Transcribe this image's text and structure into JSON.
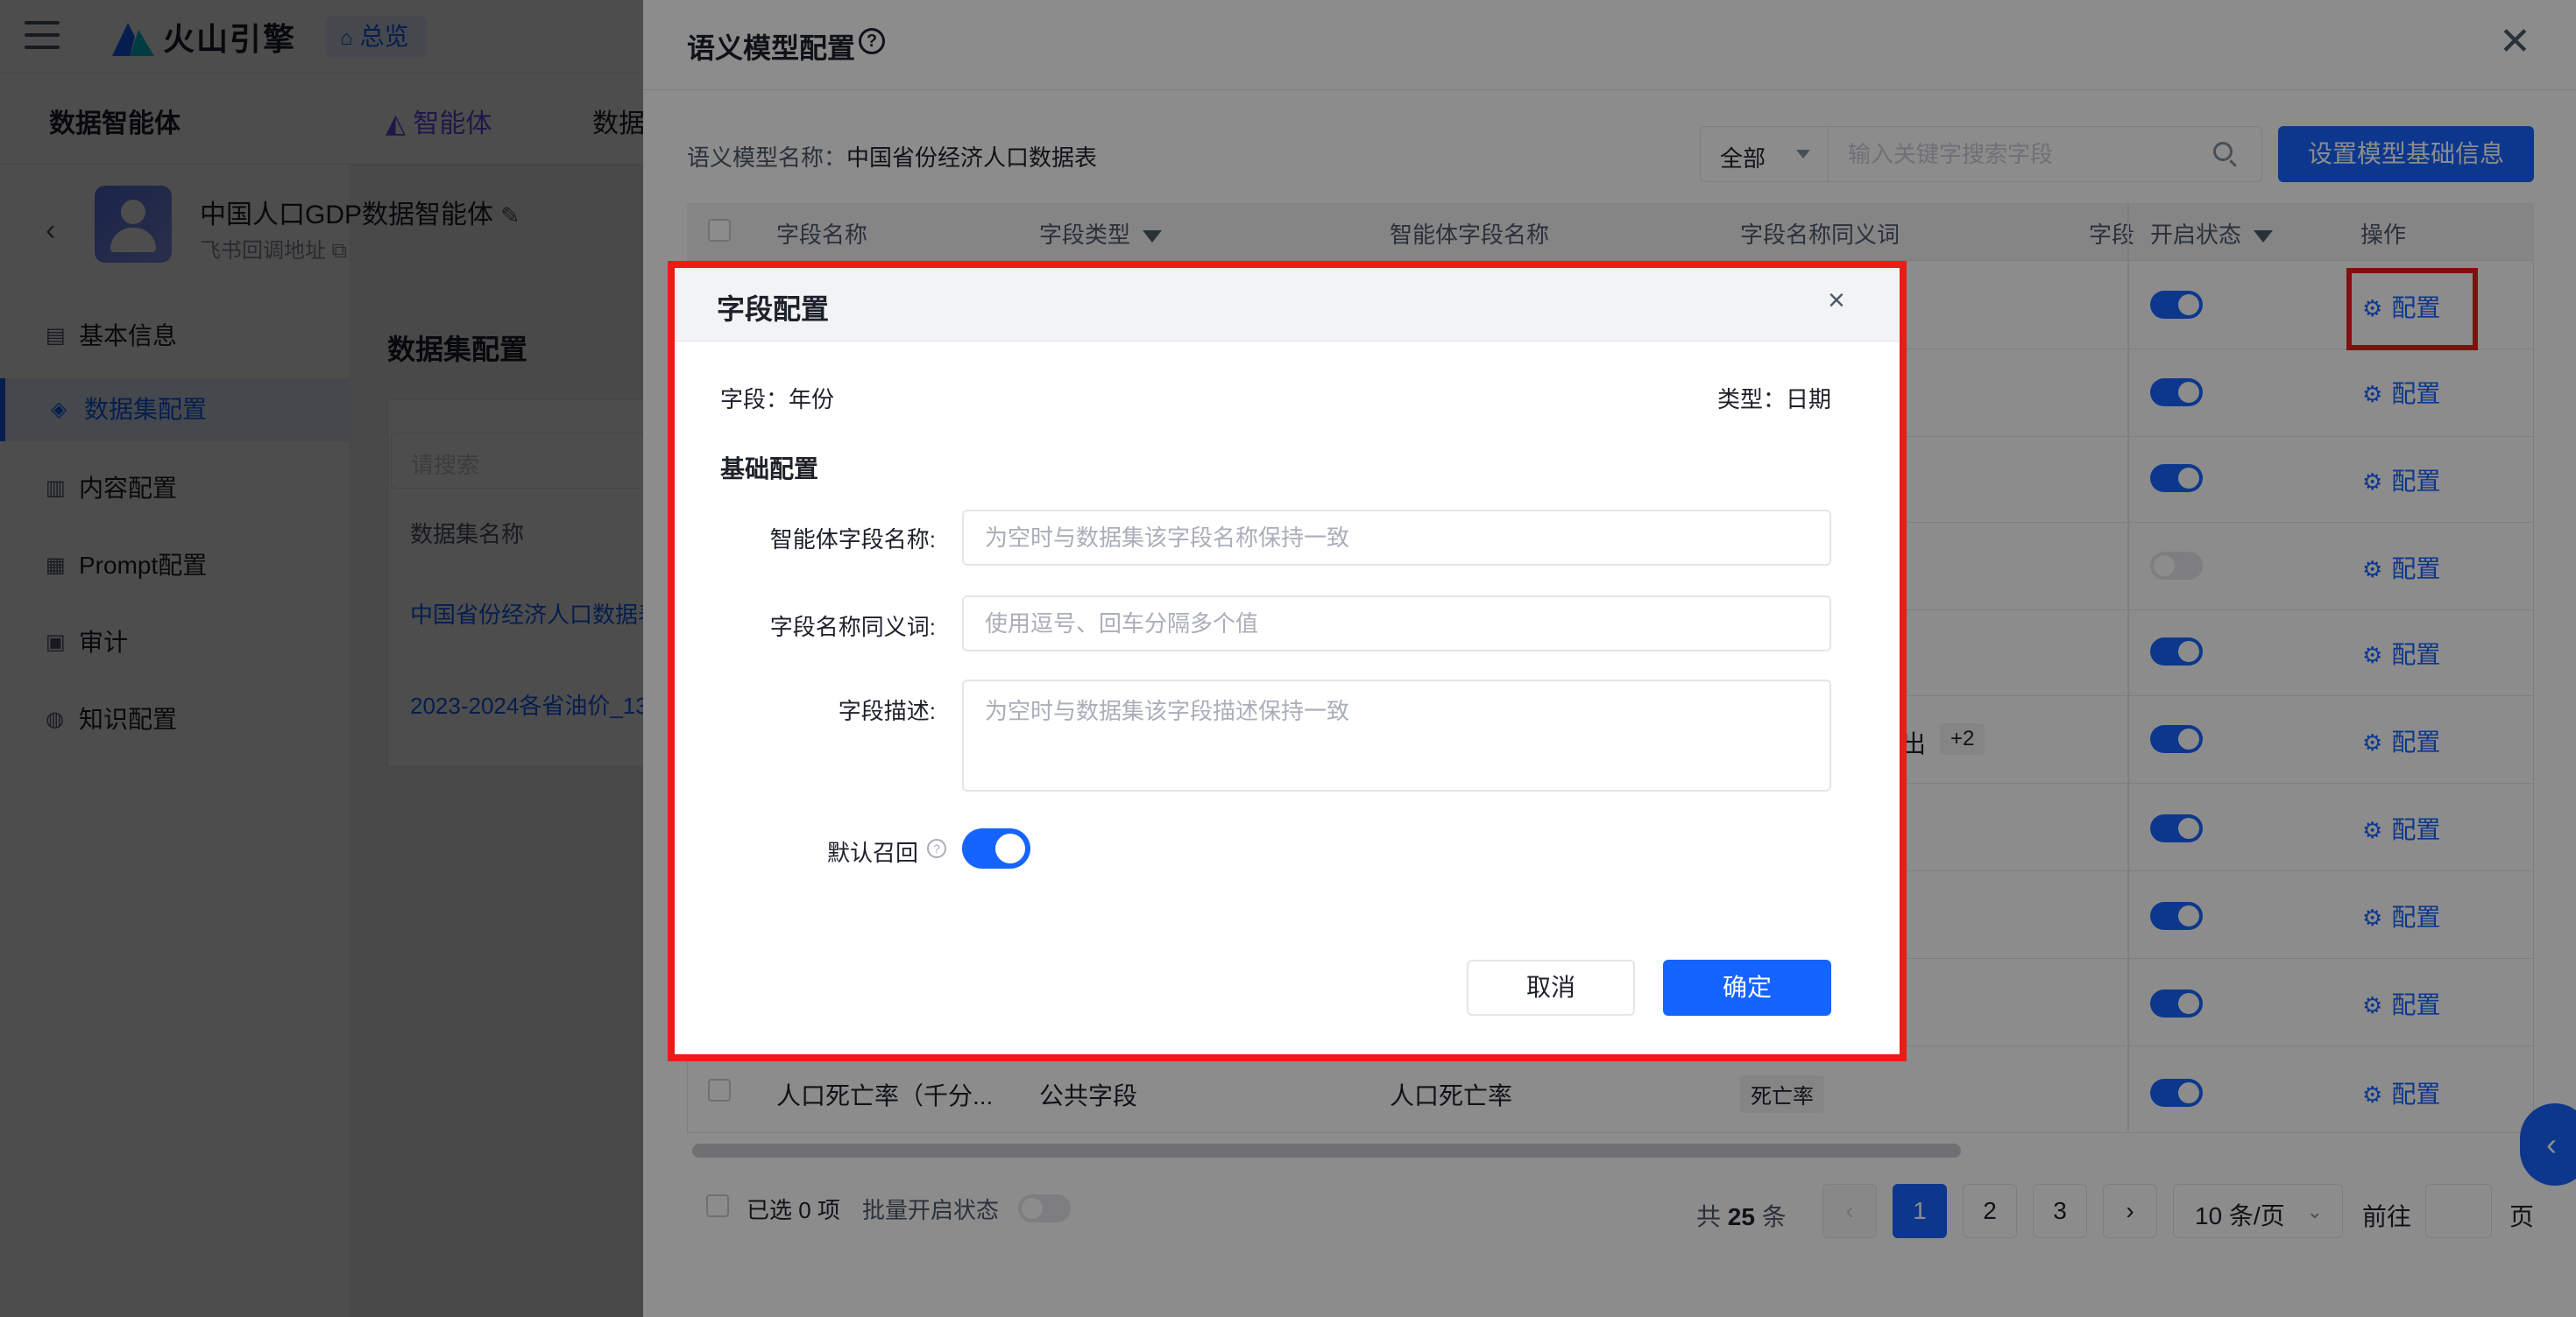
{
  "topbar": {
    "brand": "火山引擎",
    "overview": "总览"
  },
  "secbar": {
    "title": "数据智能体",
    "tab_agent": "智能体",
    "tab_data": "数据"
  },
  "agent": {
    "name": "中国人口GDP数据智能体",
    "sub": "飞书回调地址"
  },
  "sidebar": {
    "items": [
      {
        "label": "基本信息",
        "icon": "doc-icon"
      },
      {
        "label": "数据集配置",
        "icon": "layers-icon"
      },
      {
        "label": "内容配置",
        "icon": "grid-icon"
      },
      {
        "label": "Prompt配置",
        "icon": "terminal-icon"
      },
      {
        "label": "审计",
        "icon": "monitor-icon"
      },
      {
        "label": "知识配置",
        "icon": "bulb-icon"
      }
    ]
  },
  "content": {
    "title": "数据集配置",
    "search_placeholder": "请搜索",
    "col_name": "数据集名称",
    "links": [
      "中国省份经济人口数据表",
      "2023-2024各省油价_13"
    ]
  },
  "drawer": {
    "title": "语义模型配置",
    "model_name_label": "语义模型名称：",
    "model_name_value": "中国省份经济人口数据表",
    "filter_value": "全部",
    "search_placeholder": "输入关键字搜索字段",
    "set_base_button": "设置模型基础信息",
    "columns": {
      "field_name": "字段名称",
      "field_type": "字段类型",
      "agent_field_name": "智能体字段名称",
      "synonyms": "字段名称同义词",
      "desc_partial": "字段",
      "status": "开启状态",
      "action": "操作"
    },
    "rows": [
      {
        "enabled": true
      },
      {
        "enabled": true
      },
      {
        "enabled": true
      },
      {
        "enabled": false
      },
      {
        "enabled": true
      },
      {
        "enabled": true,
        "syn_partial": "出",
        "more": "+2"
      },
      {
        "enabled": true
      },
      {
        "enabled": true
      },
      {
        "enabled": true
      },
      {
        "enabled": true,
        "field_name": "人口死亡率（千分...",
        "field_type": "公共字段",
        "agent_field_name": "人口死亡率",
        "synonym": "死亡率"
      }
    ],
    "config_label": "配置",
    "footer": {
      "selected": "已选 0 项",
      "batch": "批量开启状态",
      "total_prefix": "共 ",
      "total": "25",
      "total_suffix": " 条",
      "pages": [
        "1",
        "2",
        "3"
      ],
      "prev": "‹",
      "next": "›",
      "page_size": "10 条/页",
      "goto": "前往",
      "page_unit": "页"
    }
  },
  "modal": {
    "title": "字段配置",
    "field": "字段：年份",
    "type": "类型：日期",
    "section": "基础配置",
    "agent_field_label": "智能体字段名称:",
    "agent_field_placeholder": "为空时与数据集该字段名称保持一致",
    "synonym_label": "字段名称同义词:",
    "synonym_placeholder": "使用逗号、回车分隔多个值",
    "desc_label": "字段描述:",
    "desc_placeholder": "为空时与数据集该字段描述保持一致",
    "recall_label": "默认召回",
    "recall_enabled": true,
    "cancel": "取消",
    "ok": "确定"
  },
  "colors": {
    "primary": "#1664ff",
    "highlight": "#ee1a1a"
  }
}
